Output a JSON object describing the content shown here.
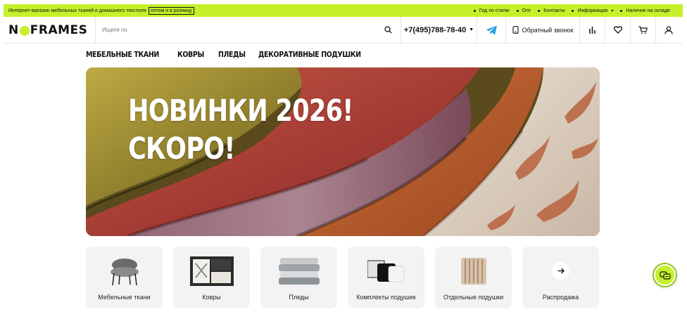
{
  "topbar": {
    "tagline": "Интернет-магазин мебельных тканей и домашнего текстиля",
    "tag_box": "оптом и в розницу",
    "links": [
      "Гид по стилю",
      "Опт",
      "Контакты",
      "Информация",
      "Наличие на складе"
    ]
  },
  "header": {
    "logo": "NOFRAMES",
    "search_placeholder": "Ищите по",
    "phone": "+7(495)788-78-40",
    "callback": "Обратный звонок"
  },
  "categories": [
    "МЕБЕЛЬНЫЕ ТКАНИ",
    "КОВРЫ",
    "ПЛЕДЫ",
    "ДЕКОРАТИВНЫЕ ПОДУШКИ"
  ],
  "banner": {
    "line1": "НОВИНКИ 2026!",
    "line2": "СКОРО!"
  },
  "tiles": [
    {
      "label": "Мебельные ткани",
      "icon": "armchair-image"
    },
    {
      "label": "Ковры",
      "icon": "rug-image"
    },
    {
      "label": "Пледы",
      "icon": "blankets-image"
    },
    {
      "label": "Комплекты подушек",
      "icon": "pillow-set-image"
    },
    {
      "label": "Отдельные подушки",
      "icon": "pillow-image"
    },
    {
      "label": "Распродажа",
      "icon": "arrow-right-icon"
    }
  ],
  "colors": {
    "accent": "#c5f02a",
    "tile_bg": "#f3f3f3",
    "telegram": "#2aa3df"
  }
}
